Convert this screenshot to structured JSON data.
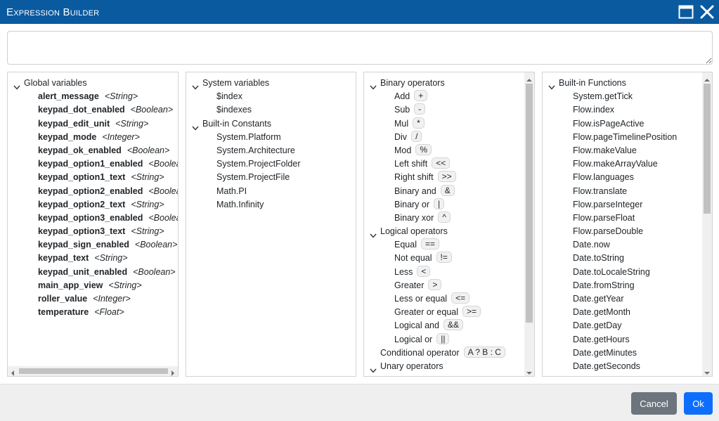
{
  "window": {
    "title": "Expression Builder",
    "icons": {
      "maximize": "window-maximize-icon",
      "close": "close-x-icon"
    }
  },
  "expression": {
    "value": "",
    "placeholder": ""
  },
  "panels": [
    {
      "id": "p1",
      "rows": [
        {
          "kind": "header",
          "label": "Global variables"
        },
        {
          "kind": "item",
          "label": "alert_message",
          "type": "<String>"
        },
        {
          "kind": "item",
          "label": "keypad_dot_enabled",
          "type": "<Boolean>"
        },
        {
          "kind": "item",
          "label": "keypad_edit_unit",
          "type": "<String>"
        },
        {
          "kind": "item",
          "label": "keypad_mode",
          "type": "<Integer>"
        },
        {
          "kind": "item",
          "label": "keypad_ok_enabled",
          "type": "<Boolean>"
        },
        {
          "kind": "item",
          "label": "keypad_option1_enabled",
          "type": "<Boolean>"
        },
        {
          "kind": "item",
          "label": "keypad_option1_text",
          "type": "<String>"
        },
        {
          "kind": "item",
          "label": "keypad_option2_enabled",
          "type": "<Boolean>"
        },
        {
          "kind": "item",
          "label": "keypad_option2_text",
          "type": "<String>"
        },
        {
          "kind": "item",
          "label": "keypad_option3_enabled",
          "type": "<Boolean>"
        },
        {
          "kind": "item",
          "label": "keypad_option3_text",
          "type": "<String>"
        },
        {
          "kind": "item",
          "label": "keypad_sign_enabled",
          "type": "<Boolean>"
        },
        {
          "kind": "item",
          "label": "keypad_text",
          "type": "<String>"
        },
        {
          "kind": "item",
          "label": "keypad_unit_enabled",
          "type": "<Boolean>"
        },
        {
          "kind": "item",
          "label": "main_app_view",
          "type": "<String>"
        },
        {
          "kind": "item",
          "label": "roller_value",
          "type": "<Integer>"
        },
        {
          "kind": "item",
          "label": "temperature",
          "type": "<Float>"
        }
      ]
    },
    {
      "id": "p2",
      "rows": [
        {
          "kind": "header",
          "label": "System variables"
        },
        {
          "kind": "item",
          "label": "$index"
        },
        {
          "kind": "item",
          "label": "$indexes"
        },
        {
          "kind": "header",
          "label": "Built-in Constants"
        },
        {
          "kind": "item",
          "label": "System.Platform"
        },
        {
          "kind": "item",
          "label": "System.Architecture"
        },
        {
          "kind": "item",
          "label": "System.ProjectFolder"
        },
        {
          "kind": "item",
          "label": "System.ProjectFile"
        },
        {
          "kind": "item",
          "label": "Math.PI"
        },
        {
          "kind": "item",
          "label": "Math.Infinity"
        }
      ]
    },
    {
      "id": "p3",
      "rows": [
        {
          "kind": "header",
          "label": "Binary operators"
        },
        {
          "kind": "item",
          "label": "Add",
          "op": "+"
        },
        {
          "kind": "item",
          "label": "Sub",
          "op": "-"
        },
        {
          "kind": "item",
          "label": "Mul",
          "op": "*"
        },
        {
          "kind": "item",
          "label": "Div",
          "op": "/"
        },
        {
          "kind": "item",
          "label": "Mod",
          "op": "%"
        },
        {
          "kind": "item",
          "label": "Left shift",
          "op": "<<"
        },
        {
          "kind": "item",
          "label": "Right shift",
          "op": ">>"
        },
        {
          "kind": "item",
          "label": "Binary and",
          "op": "&"
        },
        {
          "kind": "item",
          "label": "Binary or",
          "op": "|"
        },
        {
          "kind": "item",
          "label": "Binary xor",
          "op": "^"
        },
        {
          "kind": "header",
          "label": "Logical operators"
        },
        {
          "kind": "item",
          "label": "Equal",
          "op": "=="
        },
        {
          "kind": "item",
          "label": "Not equal",
          "op": "!="
        },
        {
          "kind": "item",
          "label": "Less",
          "op": "<"
        },
        {
          "kind": "item",
          "label": "Greater",
          "op": ">"
        },
        {
          "kind": "item",
          "label": "Less or equal",
          "op": "<="
        },
        {
          "kind": "item",
          "label": "Greater or equal",
          "op": ">="
        },
        {
          "kind": "item",
          "label": "Logical and",
          "op": "&&"
        },
        {
          "kind": "item",
          "label": "Logical or",
          "op": "||"
        },
        {
          "kind": "item-1",
          "label": "Conditional operator",
          "op": "A ? B : C"
        },
        {
          "kind": "header",
          "label": "Unary operators"
        }
      ]
    },
    {
      "id": "p4",
      "rows": [
        {
          "kind": "header",
          "label": "Built-in Functions"
        },
        {
          "kind": "item",
          "label": "System.getTick"
        },
        {
          "kind": "item",
          "label": "Flow.index"
        },
        {
          "kind": "item",
          "label": "Flow.isPageActive"
        },
        {
          "kind": "item",
          "label": "Flow.pageTimelinePosition"
        },
        {
          "kind": "item",
          "label": "Flow.makeValue"
        },
        {
          "kind": "item",
          "label": "Flow.makeArrayValue"
        },
        {
          "kind": "item",
          "label": "Flow.languages"
        },
        {
          "kind": "item",
          "label": "Flow.translate"
        },
        {
          "kind": "item",
          "label": "Flow.parseInteger"
        },
        {
          "kind": "item",
          "label": "Flow.parseFloat"
        },
        {
          "kind": "item",
          "label": "Flow.parseDouble"
        },
        {
          "kind": "item",
          "label": "Date.now"
        },
        {
          "kind": "item",
          "label": "Date.toString"
        },
        {
          "kind": "item",
          "label": "Date.toLocaleString"
        },
        {
          "kind": "item",
          "label": "Date.fromString"
        },
        {
          "kind": "item",
          "label": "Date.getYear"
        },
        {
          "kind": "item",
          "label": "Date.getMonth"
        },
        {
          "kind": "item",
          "label": "Date.getDay"
        },
        {
          "kind": "item",
          "label": "Date.getHours"
        },
        {
          "kind": "item",
          "label": "Date.getMinutes"
        },
        {
          "kind": "item",
          "label": "Date.getSeconds"
        }
      ]
    }
  ],
  "scroll": {
    "panel3_vertical_fraction": 0.0,
    "panel4_vertical_fraction": 0.0,
    "panel1_horizontal_fraction": 0.0
  },
  "footer": {
    "cancel_label": "Cancel",
    "ok_label": "Ok"
  },
  "colors": {
    "titlebar": "#0a5aa0",
    "ok_button": "#0d6efd",
    "cancel_button": "#6c757d"
  }
}
